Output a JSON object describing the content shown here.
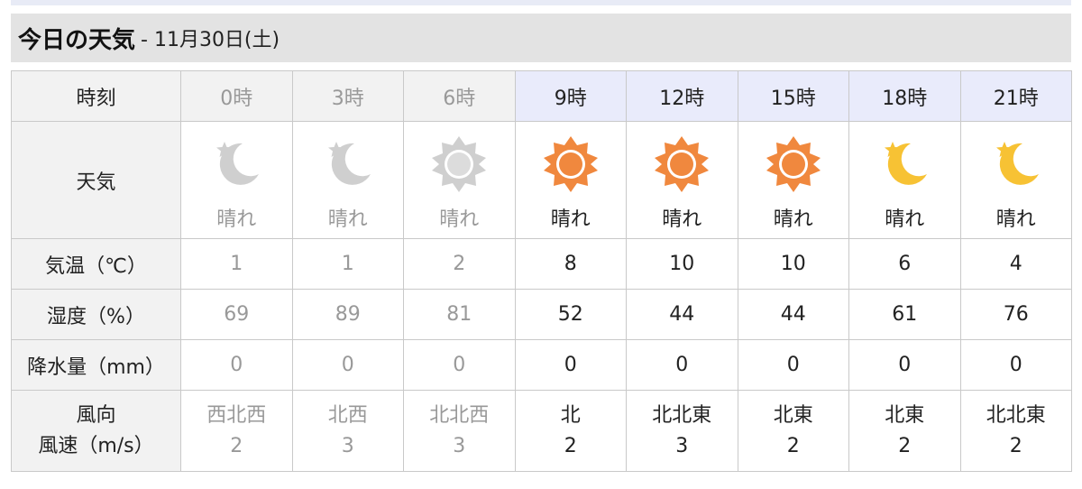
{
  "header": {
    "title": "今日の天気",
    "date": "- 11月30日(土)"
  },
  "labels": {
    "time": "時刻",
    "weather": "天気",
    "temp": "気温（℃）",
    "humidity": "湿度（%）",
    "precip": "降水量（mm）",
    "wind_dir": "風向",
    "wind_speed": "風速（m/s）"
  },
  "hours": [
    {
      "time": "0時",
      "past": true,
      "icon": "moon-icon",
      "weather": "晴れ",
      "temp": "1",
      "humidity": "69",
      "precip": "0",
      "wind_dir": "西北西",
      "wind_speed": "2"
    },
    {
      "time": "3時",
      "past": true,
      "icon": "moon-icon",
      "weather": "晴れ",
      "temp": "1",
      "humidity": "89",
      "precip": "0",
      "wind_dir": "北西",
      "wind_speed": "3"
    },
    {
      "time": "6時",
      "past": true,
      "icon": "sun-icon",
      "weather": "晴れ",
      "temp": "2",
      "humidity": "81",
      "precip": "0",
      "wind_dir": "北北西",
      "wind_speed": "3"
    },
    {
      "time": "9時",
      "past": false,
      "icon": "sun-icon",
      "weather": "晴れ",
      "temp": "8",
      "humidity": "52",
      "precip": "0",
      "wind_dir": "北",
      "wind_speed": "2"
    },
    {
      "time": "12時",
      "past": false,
      "icon": "sun-icon",
      "weather": "晴れ",
      "temp": "10",
      "humidity": "44",
      "precip": "0",
      "wind_dir": "北北東",
      "wind_speed": "3"
    },
    {
      "time": "15時",
      "past": false,
      "icon": "sun-icon",
      "weather": "晴れ",
      "temp": "10",
      "humidity": "44",
      "precip": "0",
      "wind_dir": "北東",
      "wind_speed": "2"
    },
    {
      "time": "18時",
      "past": false,
      "icon": "moon-icon",
      "weather": "晴れ",
      "temp": "6",
      "humidity": "61",
      "precip": "0",
      "wind_dir": "北東",
      "wind_speed": "2"
    },
    {
      "time": "21時",
      "past": false,
      "icon": "moon-icon",
      "weather": "晴れ",
      "temp": "4",
      "humidity": "76",
      "precip": "0",
      "wind_dir": "北北東",
      "wind_speed": "2"
    }
  ],
  "colors": {
    "past_icon": "#cfcfcf",
    "past_sun_inner": "#dcdcdc",
    "sun_orange": "#f0883e",
    "moon_yellow": "#f7c234",
    "current_header_bg": "#e9ebfb"
  }
}
